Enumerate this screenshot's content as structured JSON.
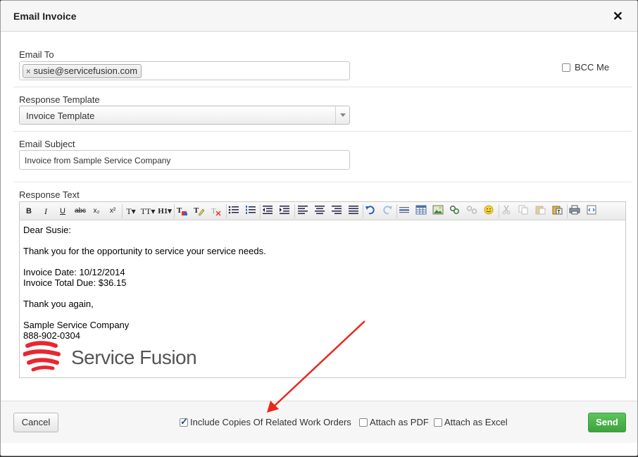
{
  "header": {
    "title": "Email Invoice",
    "close_glyph": "✕"
  },
  "email_to": {
    "label": "Email To",
    "recipients": [
      {
        "remove_glyph": "×",
        "email": "susie@servicefusion.com"
      }
    ],
    "bcc_label": "BCC Me",
    "bcc_checked": false
  },
  "template": {
    "label": "Response Template",
    "selected": "Invoice Template"
  },
  "subject": {
    "label": "Email Subject",
    "value": "Invoice from Sample Service Company"
  },
  "response": {
    "label": "Response Text",
    "toolbar": {
      "bold": "B",
      "italic": "I",
      "underline": "U",
      "strike": "abc",
      "subscript": "x₂",
      "superscript": "x²",
      "font": "T▾",
      "font_size": "TT▾",
      "heading": "H1▾"
    },
    "body": {
      "greeting": "Dear Susie:",
      "line1": "Thank you for the opportunity to service your service needs.",
      "invoice_date": "Invoice Date: 10/12/2014",
      "invoice_total": "Invoice Total Due: $36.15",
      "thanks": "Thank you again,",
      "company": "Sample Service Company",
      "phone": "888-902-0304",
      "logo_text": "Service Fusion"
    }
  },
  "footer": {
    "cancel_label": "Cancel",
    "send_label": "Send",
    "options": [
      {
        "label": "Include Copies Of Related Work Orders",
        "checked": true
      },
      {
        "label": "Attach as PDF",
        "checked": false
      },
      {
        "label": "Attach as Excel",
        "checked": false
      }
    ]
  },
  "colors": {
    "send": "#4cb34c",
    "annotation_arrow": "#e8281c",
    "logo_red": "#e8272f"
  }
}
